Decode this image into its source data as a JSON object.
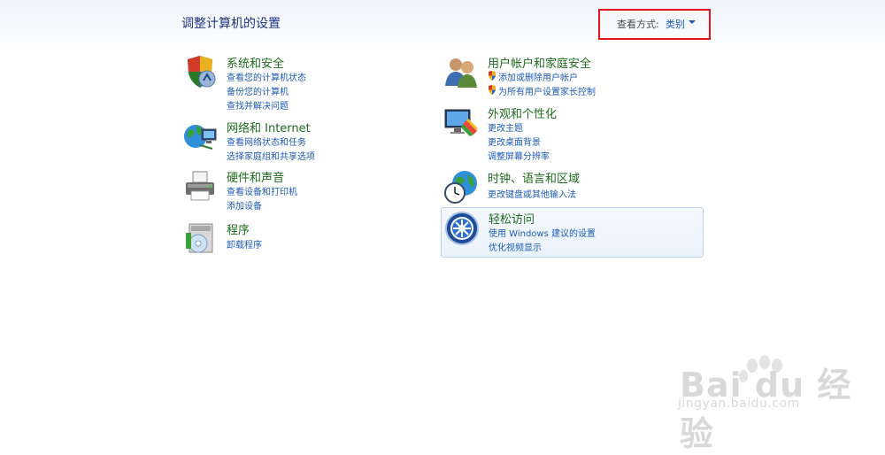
{
  "page_title": "调整计算机的设置",
  "view_by": {
    "label": "查看方式:",
    "value": "类别"
  },
  "categories": [
    {
      "id": "system",
      "title": "系统和安全",
      "icon": "shield-icon",
      "links": [
        "查看您的计算机状态",
        "备份您的计算机",
        "查找并解决问题"
      ]
    },
    {
      "id": "network",
      "title": "网络和 Internet",
      "icon": "network-globe-icon",
      "links": [
        "查看网络状态和任务",
        "选择家庭组和共享选项"
      ]
    },
    {
      "id": "hardware",
      "title": "硬件和声音",
      "icon": "printer-icon",
      "links": [
        "查看设备和打印机",
        "添加设备"
      ]
    },
    {
      "id": "programs",
      "title": "程序",
      "icon": "programs-disc-icon",
      "links": [
        "卸载程序"
      ]
    },
    {
      "id": "users",
      "title": "用户帐户和家庭安全",
      "icon": "users-icon",
      "links": [
        "添加或删除用户帐户",
        "为所有用户设置家长控制"
      ]
    },
    {
      "id": "appearance",
      "title": "外观和个性化",
      "icon": "monitor-palette-icon",
      "links": [
        "更改主题",
        "更改桌面背景",
        "调整屏幕分辨率"
      ]
    },
    {
      "id": "clock",
      "title": "时钟、语言和区域",
      "icon": "clock-globe-icon",
      "links": [
        "更改键盘或其他输入法"
      ]
    },
    {
      "id": "ease",
      "title": "轻松访问",
      "icon": "ease-of-access-icon",
      "links": [
        "使用 Windows 建议的设置",
        "优化视频显示"
      ]
    }
  ],
  "watermark": {
    "big": "Bai du 经验",
    "small": "jingyan.baidu.com"
  },
  "colors": {
    "title_blue": "#1e3287",
    "link_blue": "#1e5ab4",
    "category_green": "#1d6b1d",
    "highlight_red": "#e0141e"
  }
}
